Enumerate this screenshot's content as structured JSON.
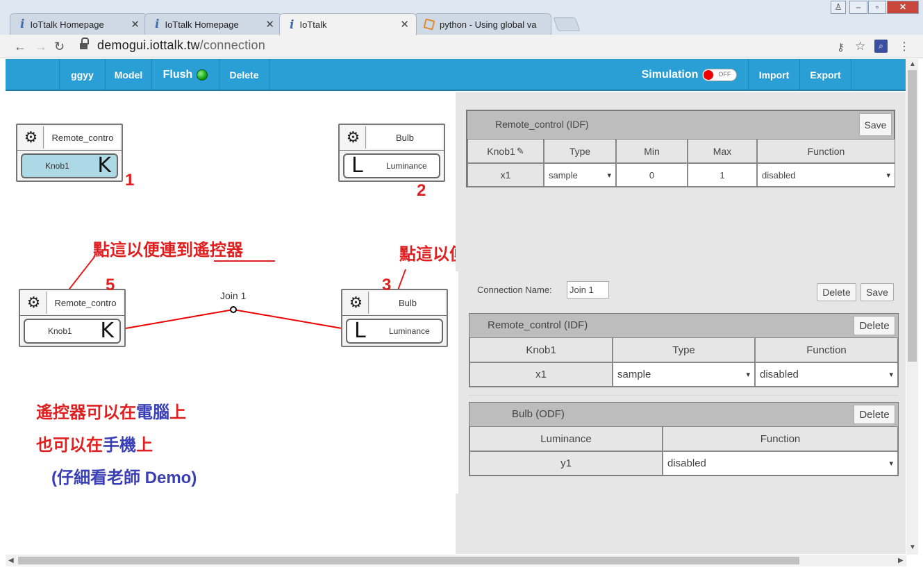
{
  "browser": {
    "tabs": [
      {
        "label": "IoTtalk Homepage",
        "icon": "iottalk-icon"
      },
      {
        "label": "IoTtalk Homepage",
        "icon": "iottalk-icon"
      },
      {
        "label": "IoTtalk",
        "icon": "iottalk-icon"
      },
      {
        "label": "python - Using global va",
        "icon": "stackoverflow-icon"
      }
    ],
    "url_host": "demogui.iottalk.tw",
    "url_path": "/connection"
  },
  "toolbar": {
    "project": "ggyy",
    "model": "Model",
    "flush": "Flush",
    "delete": "Delete",
    "simulation": "Simulation",
    "sim_state": "OFF",
    "import": "Import",
    "export": "Export"
  },
  "canvas": {
    "devices": [
      {
        "name": "Remote_contro",
        "feature": "Knob1",
        "letter": "K"
      },
      {
        "name": "Bulb",
        "feature": "Luminance",
        "letter": "L"
      },
      {
        "name": "Remote_contro",
        "feature": "Knob1",
        "letter": "K"
      },
      {
        "name": "Bulb",
        "feature": "Luminance",
        "letter": "L"
      }
    ],
    "join_label": "Join 1",
    "numbers": [
      "1",
      "2",
      "5",
      "3"
    ],
    "annotations": {
      "click_remote": "點這以便連到遙控器",
      "click_bulb": "點這以便連到燈泡",
      "line1_a": "遙控器可以在",
      "line1_b": "電腦",
      "line1_c": "上",
      "line2_a": "也可以在",
      "line2_b": "手機",
      "line2_c": "上",
      "line3": "(仔細看老師 Demo)"
    }
  },
  "idf_panel": {
    "title": "Remote_control (IDF)",
    "save": "Save",
    "headers": [
      "Knob1",
      "Type",
      "Min",
      "Max",
      "Function"
    ],
    "row": {
      "name": "x1",
      "type": "sample",
      "min": "0",
      "max": "1",
      "function": "disabled"
    }
  },
  "connection": {
    "name_label": "Connection Name:",
    "name_value": "Join 1",
    "delete": "Delete",
    "save": "Save",
    "idf": {
      "title": "Remote_control (IDF)",
      "delete": "Delete",
      "headers": [
        "Knob1",
        "Type",
        "Function"
      ],
      "row": {
        "name": "x1",
        "type": "sample",
        "function": "disabled"
      }
    },
    "odf": {
      "title": "Bulb (ODF)",
      "delete": "Delete",
      "headers": [
        "Luminance",
        "Function"
      ],
      "row": {
        "name": "y1",
        "function": "disabled"
      }
    }
  }
}
